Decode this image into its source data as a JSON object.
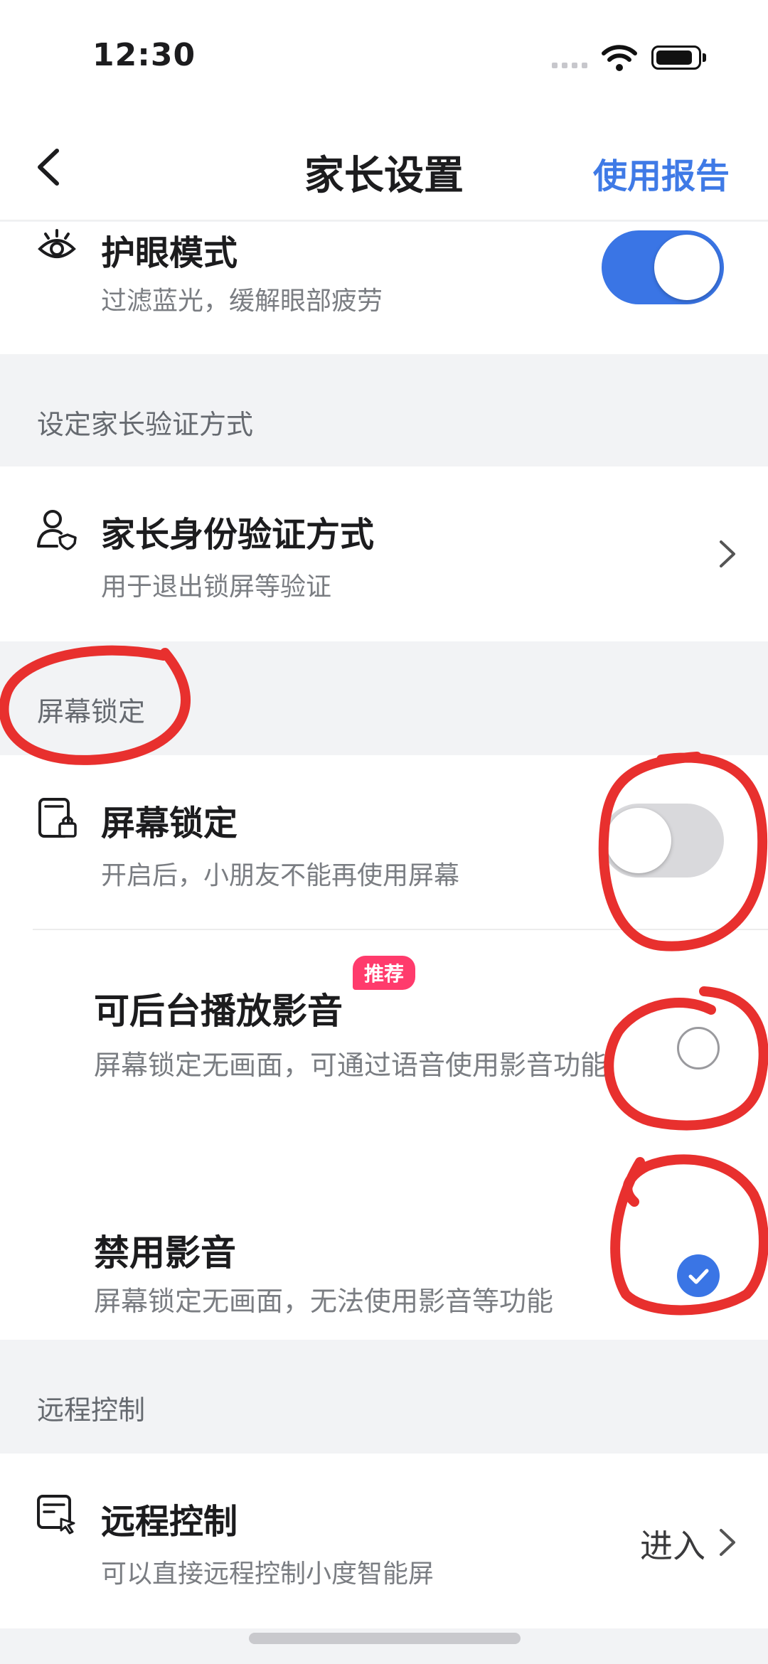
{
  "status_bar": {
    "time": "12:30"
  },
  "nav": {
    "title": "家长设置",
    "right_link": "使用报告"
  },
  "eye_mode": {
    "title": "护眼模式",
    "subtitle": "过滤蓝光，缓解眼部疲劳",
    "enabled": true
  },
  "verify_section": {
    "header": "设定家长验证方式",
    "item": {
      "title": "家长身份验证方式",
      "subtitle": "用于退出锁屏等验证"
    }
  },
  "lock_section": {
    "header": "屏幕锁定",
    "lock": {
      "title": "屏幕锁定",
      "subtitle": "开启后，小朋友不能再使用屏幕",
      "enabled": false
    },
    "options": [
      {
        "title": "可后台播放影音",
        "badge": "推荐",
        "subtitle": "屏幕锁定无画面，可通过语音使用影音功能",
        "selected": false
      },
      {
        "title": "禁用影音",
        "subtitle": "屏幕锁定无画面，无法使用影音等功能",
        "selected": true
      }
    ]
  },
  "remote_section": {
    "header": "远程控制",
    "item": {
      "title": "远程控制",
      "subtitle": "可以直接远程控制小度智能屏",
      "action": "进入"
    }
  },
  "colors": {
    "accent": "#3a75e5",
    "badge": "#ff3b6c",
    "annotation": "#e8302e",
    "background": "#f2f3f5"
  }
}
